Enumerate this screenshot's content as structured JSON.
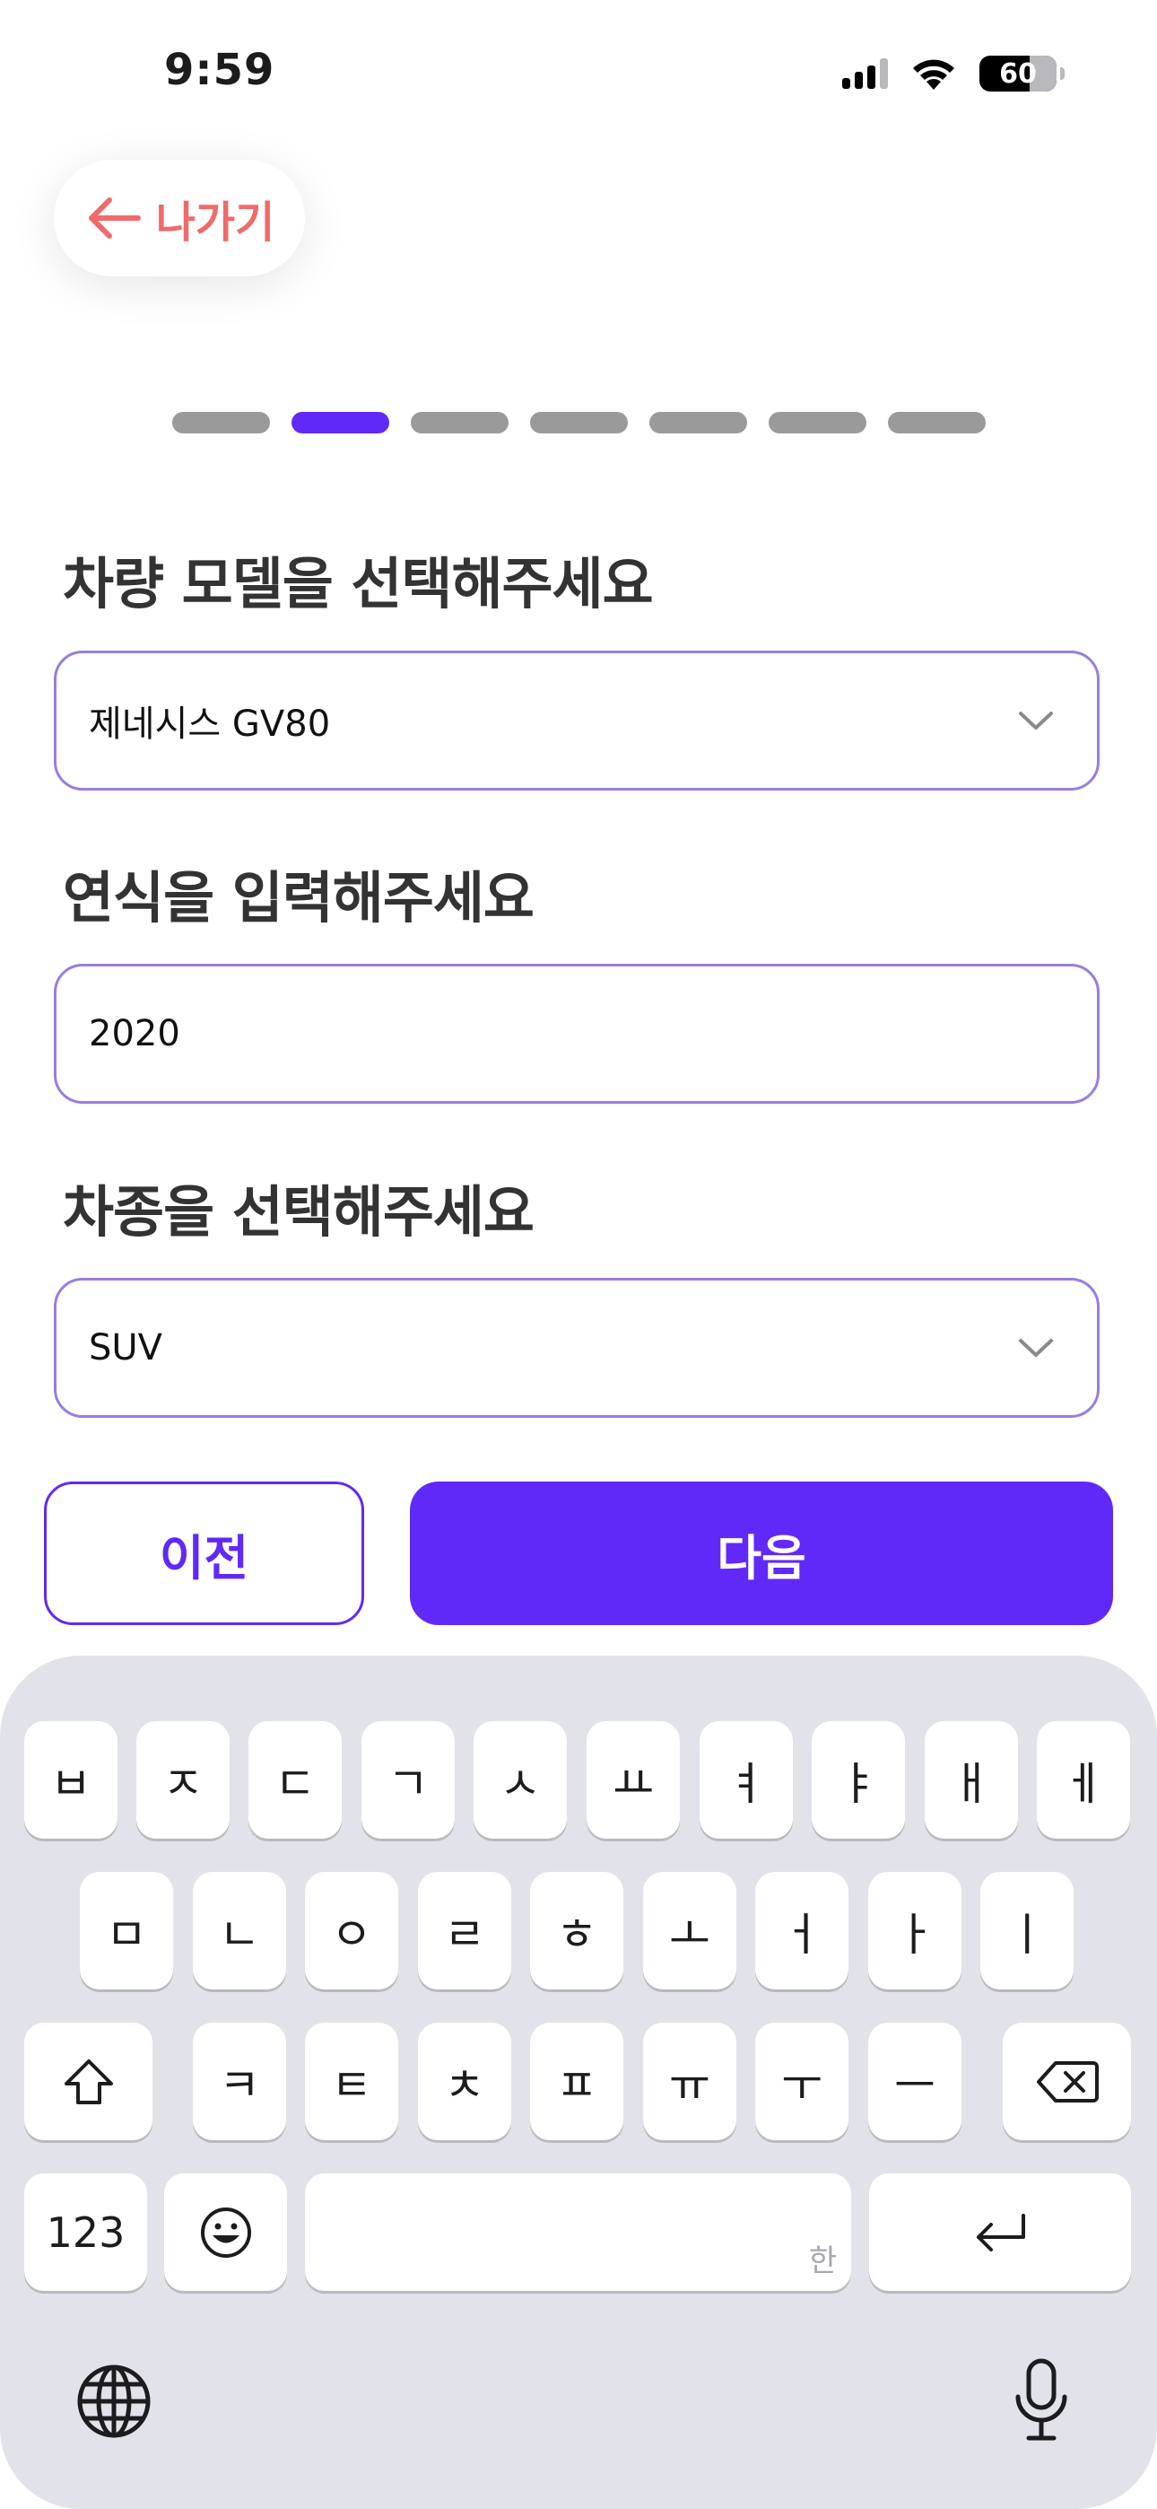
{
  "status": {
    "time": "9:59",
    "battery": "60"
  },
  "back": {
    "label": "나가기"
  },
  "progress": {
    "total": 7,
    "current": 2
  },
  "form": {
    "model_label": "차량 모델을 선택해주세요",
    "model_value": "제네시스 GV80",
    "year_label": "연식을 입력해주세요",
    "year_value": "2020",
    "type_label": "차종을 선택해주세요",
    "type_value": "SUV"
  },
  "buttons": {
    "prev": "이전",
    "next": "다음"
  },
  "keyboard": {
    "row1": [
      "ㅂ",
      "ㅈ",
      "ㄷ",
      "ㄱ",
      "ㅅ",
      "ㅛ",
      "ㅕ",
      "ㅑ",
      "ㅐ",
      "ㅔ"
    ],
    "row2": [
      "ㅁ",
      "ㄴ",
      "ㅇ",
      "ㄹ",
      "ㅎ",
      "ㅗ",
      "ㅓ",
      "ㅏ",
      "ㅣ"
    ],
    "row3": [
      "ㅋ",
      "ㅌ",
      "ㅊ",
      "ㅍ",
      "ㅠ",
      "ㅜ",
      "ㅡ"
    ],
    "numbers_key": "123",
    "space_hint": "한",
    "icons": [
      "shift-icon",
      "backspace-icon",
      "emoji-icon",
      "return-icon",
      "globe-icon",
      "microphone-icon"
    ]
  },
  "colors": {
    "accent": "#6129f7",
    "back_text": "#ef6a6a",
    "field_border": "#9a7ce0",
    "keyboard_bg": "#e2e2ea"
  }
}
